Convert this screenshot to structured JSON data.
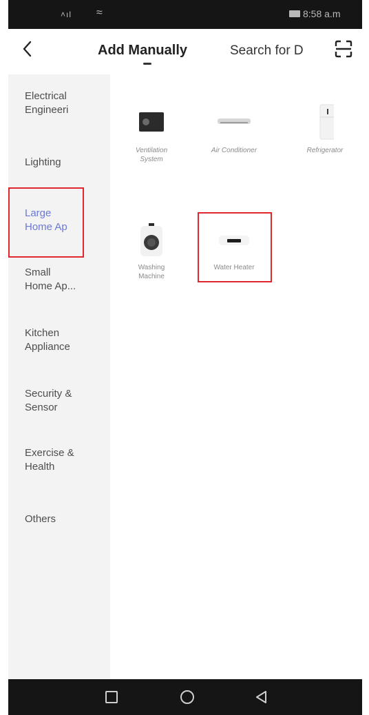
{
  "status_bar": {
    "signal": "˄ıl",
    "wifi": "≈",
    "time": "8:58 a.m"
  },
  "header": {
    "title": "Add Manually",
    "search": "Search for D"
  },
  "sidebar": {
    "items": [
      {
        "label": "Electrical\nEngineeri",
        "active": false
      },
      {
        "label": "Lighting",
        "active": false
      },
      {
        "label": "Large\nHome Ap",
        "active": true
      },
      {
        "label": "Small\nHome Ap...",
        "active": false
      },
      {
        "label": "Kitchen\nAppliance",
        "active": false
      },
      {
        "label": "Security &\nSensor",
        "active": false
      },
      {
        "label": "Exercise &\nHealth",
        "active": false
      },
      {
        "label": "Others",
        "active": false
      }
    ]
  },
  "devices": [
    {
      "name": "Ventilation\nSystem"
    },
    {
      "name": "Air Conditioner"
    },
    {
      "name": "Refrigerator"
    },
    {
      "name": "Washing\nMachine"
    },
    {
      "name": "Water Heater"
    }
  ],
  "icons": {
    "back": "chevron-left-icon",
    "scan": "scan-icon",
    "nav_recent": "square-icon",
    "nav_home": "circle-icon",
    "nav_back": "triangle-back-icon"
  },
  "colors": {
    "active": "#6a78d6",
    "highlight": "#e0262a"
  }
}
